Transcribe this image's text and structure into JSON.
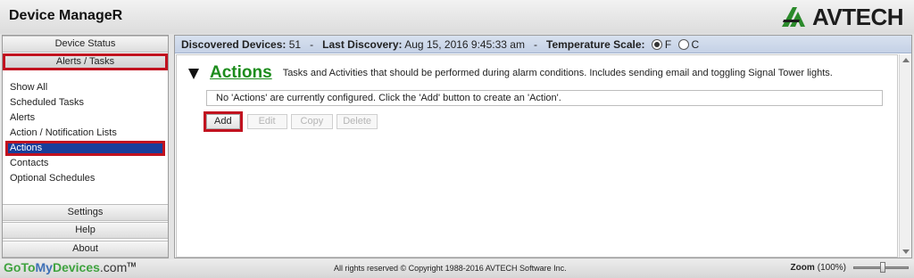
{
  "header": {
    "app_title": "Device ManageR",
    "brand_name": "AVTECH",
    "brand_icon": "avtech-logo-icon",
    "brand_color": "#2b8a2b"
  },
  "sidebar": {
    "device_status": "Device Status",
    "alerts_tasks": "Alerts / Tasks",
    "items": [
      {
        "label": "Show All"
      },
      {
        "label": "Scheduled Tasks"
      },
      {
        "label": "Alerts"
      },
      {
        "label": "Action / Notification Lists"
      },
      {
        "label": "Actions"
      },
      {
        "label": "Contacts"
      },
      {
        "label": "Optional Schedules"
      }
    ],
    "selected_item": "Actions",
    "settings": "Settings",
    "help": "Help",
    "about": "About",
    "highlight_color": "#c1121f",
    "selection_color": "#183e9b"
  },
  "status": {
    "discovered_label": "Discovered Devices:",
    "discovered_count": "51",
    "sep1": "-",
    "last_discovery_label": "Last Discovery:",
    "last_discovery_value": "Aug 15, 2016  9:45:33 am",
    "sep2": "-",
    "temp_label": "Temperature Scale:",
    "temp_f": "F",
    "temp_c": "C",
    "temp_selected": "F"
  },
  "actions": {
    "title": "Actions",
    "description": "Tasks and Activities that should be performed during alarm conditions. Includes sending email and toggling Signal Tower lights.",
    "empty_notice": "No 'Actions' are currently configured. Click the 'Add' button to create an 'Action'.",
    "title_color": "#1c8c1c",
    "buttons": {
      "add": "Add",
      "edit": "Edit",
      "copy": "Copy",
      "delete": "Delete"
    }
  },
  "footer": {
    "brand_goto": "GoTo",
    "brand_my": "My",
    "brand_devices": "Devices",
    "brand_com": ".com",
    "brand_tm": "TM",
    "copyright": "All rights reserved © Copyright 1988-2016 AVTECH Software Inc.",
    "zoom_label": "Zoom",
    "zoom_value": "(100%)",
    "zoom_level": 1.0
  }
}
